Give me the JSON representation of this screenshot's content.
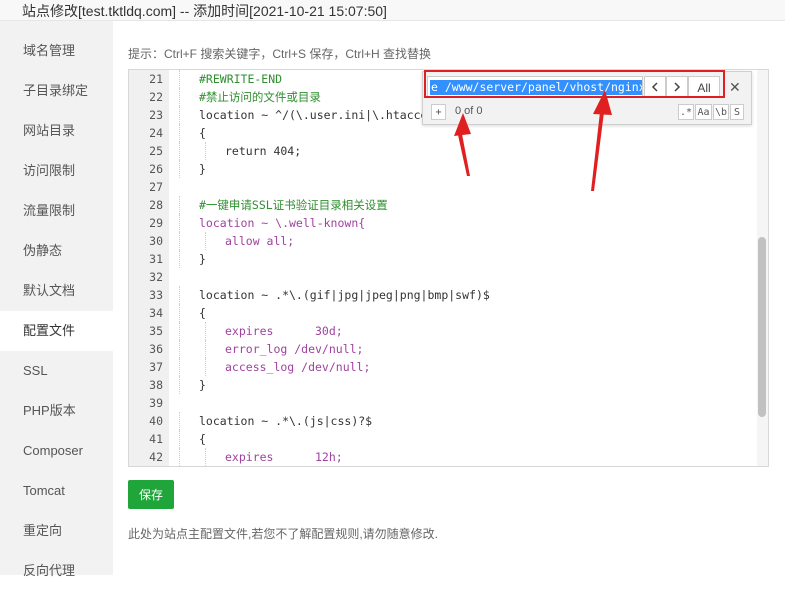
{
  "window": {
    "title": "站点修改[test.tktldq.com] -- 添加时间[2021-10-21 15:07:50]"
  },
  "sidebar": {
    "items": [
      {
        "label": "域名管理"
      },
      {
        "label": "子目录绑定"
      },
      {
        "label": "网站目录"
      },
      {
        "label": "访问限制"
      },
      {
        "label": "流量限制"
      },
      {
        "label": "伪静态"
      },
      {
        "label": "默认文档"
      },
      {
        "label": "配置文件",
        "active": true
      },
      {
        "label": "SSL"
      },
      {
        "label": "PHP版本"
      },
      {
        "label": "Composer"
      },
      {
        "label": "Tomcat"
      },
      {
        "label": "重定向"
      },
      {
        "label": "反向代理"
      }
    ]
  },
  "hint": "提示：Ctrl+F 搜索关键字，Ctrl+S 保存，Ctrl+H 查找替换",
  "editor": {
    "lines": [
      {
        "n": "21",
        "indent": 1,
        "code": "#REWRITE-END",
        "cls": "c"
      },
      {
        "n": "22",
        "indent": 1,
        "code": "#禁止访问的文件或目录",
        "cls": "c"
      },
      {
        "n": "23",
        "indent": 1,
        "code": "location ~ ^/(\\.user.ini|\\.htaccess",
        "cls": "k"
      },
      {
        "n": "24",
        "indent": 1,
        "code": "{",
        "cls": "k"
      },
      {
        "n": "25",
        "indent": 2,
        "code": "return 404;",
        "cls": "k"
      },
      {
        "n": "26",
        "indent": 1,
        "code": "}",
        "cls": "k"
      },
      {
        "n": "27",
        "indent": 0,
        "code": "",
        "cls": "k"
      },
      {
        "n": "28",
        "indent": 1,
        "code": "#一键申请SSL证书验证目录相关设置",
        "cls": "c"
      },
      {
        "n": "29",
        "indent": 1,
        "code": "location ~ \\.well-known{",
        "cls": "p"
      },
      {
        "n": "30",
        "indent": 2,
        "code": "allow all;",
        "cls": "p"
      },
      {
        "n": "31",
        "indent": 1,
        "code": "}",
        "cls": "k"
      },
      {
        "n": "32",
        "indent": 0,
        "code": "",
        "cls": "k"
      },
      {
        "n": "33",
        "indent": 1,
        "code": "location ~ .*\\.(gif|jpg|jpeg|png|bmp|swf)$",
        "cls": "k"
      },
      {
        "n": "34",
        "indent": 1,
        "code": "{",
        "cls": "k"
      },
      {
        "n": "35",
        "indent": 2,
        "code": "expires      30d;",
        "cls": "p"
      },
      {
        "n": "36",
        "indent": 2,
        "code": "error_log /dev/null;",
        "cls": "p"
      },
      {
        "n": "37",
        "indent": 2,
        "code": "access_log /dev/null;",
        "cls": "p"
      },
      {
        "n": "38",
        "indent": 1,
        "code": "}",
        "cls": "k"
      },
      {
        "n": "39",
        "indent": 0,
        "code": "",
        "cls": "k"
      },
      {
        "n": "40",
        "indent": 1,
        "code": "location ~ .*\\.(js|css)?$",
        "cls": "k"
      },
      {
        "n": "41",
        "indent": 1,
        "code": "{",
        "cls": "k"
      },
      {
        "n": "42",
        "indent": 2,
        "code": "expires      12h;",
        "cls": "p"
      }
    ]
  },
  "find": {
    "query": "e /www/server/panel/vhost/nginx",
    "prev_icon": "chevron-left-icon",
    "next_icon": "chevron-right-icon",
    "all_label": "All",
    "close_icon": "close-icon",
    "toggle_replace": "+",
    "count": "0 of 0",
    "regex_label": ".*",
    "case_label": "Aa",
    "word_label": "\\b",
    "selection_label": "S"
  },
  "save_label": "保存",
  "footnote": "此处为站点主配置文件,若您不了解配置规则,请勿随意修改.",
  "colors": {
    "accent": "#20a53a",
    "annotation": "#e02020",
    "selection": "#3390ff"
  }
}
